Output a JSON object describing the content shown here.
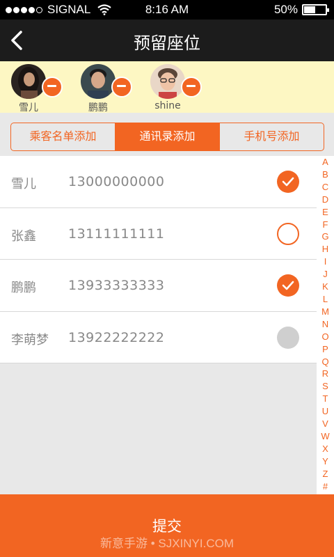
{
  "status_bar": {
    "carrier": "SIGNAL",
    "time": "8:16 AM",
    "battery": "50%"
  },
  "header": {
    "title": "预留座位"
  },
  "selected": [
    {
      "name": "雪儿"
    },
    {
      "name": "鹏鹏"
    },
    {
      "name": "shine"
    }
  ],
  "tabs": [
    {
      "label": "乘客名单添加"
    },
    {
      "label": "通讯录添加"
    },
    {
      "label": "手机号添加"
    }
  ],
  "contacts": [
    {
      "name": "雪儿",
      "phone": "13000000000",
      "state": "checked"
    },
    {
      "name": "张鑫",
      "phone": "13111111111",
      "state": "unchecked"
    },
    {
      "name": "鹏鹏",
      "phone": "13933333333",
      "state": "checked"
    },
    {
      "name": "李萌梦",
      "phone": "13922222222",
      "state": "disabled"
    }
  ],
  "index_letters": [
    "A",
    "B",
    "C",
    "D",
    "E",
    "F",
    "G",
    "H",
    "I",
    "J",
    "K",
    "L",
    "M",
    "N",
    "O",
    "P",
    "Q",
    "R",
    "S",
    "T",
    "U",
    "V",
    "W",
    "X",
    "Y",
    "Z",
    "#"
  ],
  "submit": {
    "label": "提交"
  },
  "watermark": "新意手游 • SJXINYI.COM",
  "colors": {
    "accent": "#f26522",
    "header_bg": "#1c1c1c",
    "strip_bg": "#fdf7c3"
  }
}
